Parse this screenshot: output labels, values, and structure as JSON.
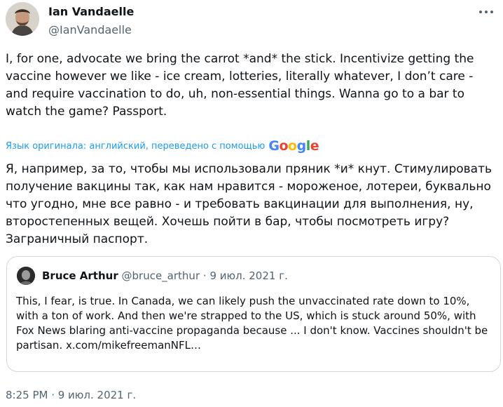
{
  "tweet": {
    "author_name": "Ian Vandaelle",
    "author_handle": "@IanVandaelle",
    "text": "I, for one, advocate we bring the carrot *and* the stick. Incentivize getting the vaccine however we like - ice cream, lotteries, literally whatever, I don’t care - and require vaccination to do, uh, non-essential things. Wanna go to a bar to watch the game? Passport.",
    "translation_notice": "Язык оригинала: английский, переведено с помощью",
    "google_label": "Google",
    "translated_text": "Я, например, за то, чтобы мы использовали пряник *и* кнут. Стимулировать получение вакцины так, как нам нравится - мороженое, лотереи, буквально что угодно, мне все равно - и требовать вакцинации для выполнения, ну, второстепенных вещей. Хочешь пойти в бар, чтобы посмотреть игру? Заграничный паспорт.",
    "timestamp": "8:25 PM · 9 июл. 2021 г."
  },
  "quote": {
    "author_name": "Bruce Arthur",
    "author_handle": "@bruce_arthur",
    "separator": "·",
    "date": "9 июл. 2021 г.",
    "text": "This, I fear, is true. In Canada, we can likely push the unvaccinated rate down to 10%, with a ton of work. And then we're strapped to the US, which is stuck around 50%, with Fox News blaring anti-vaccine propaganda because ... I don't know. Vaccines shouldn't be partisan.",
    "link": "x.com/mikefreemanNFL…"
  },
  "icons": {
    "more": "more-horizontal-icon",
    "google_colors": [
      "#4285F4",
      "#EA4335",
      "#FBBC05",
      "#4285F4",
      "#34A853",
      "#EA4335"
    ]
  }
}
